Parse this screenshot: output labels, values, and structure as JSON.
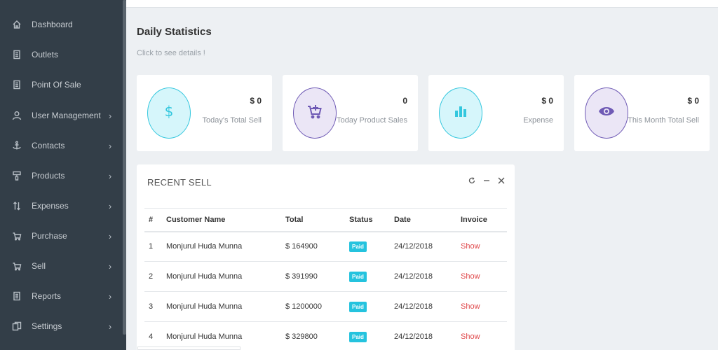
{
  "sidebar": {
    "items": [
      {
        "label": "Dashboard",
        "icon": "home-icon",
        "has_children": false
      },
      {
        "label": "Outlets",
        "icon": "document-icon",
        "has_children": false
      },
      {
        "label": "Point Of Sale",
        "icon": "document-icon",
        "has_children": false
      },
      {
        "label": "User Management",
        "icon": "user-icon",
        "has_children": true
      },
      {
        "label": "Contacts",
        "icon": "anchor-icon",
        "has_children": true
      },
      {
        "label": "Products",
        "icon": "paint-roller-icon",
        "has_children": true
      },
      {
        "label": "Expenses",
        "icon": "arrows-icon",
        "has_children": true
      },
      {
        "label": "Purchase",
        "icon": "cart-icon",
        "has_children": true
      },
      {
        "label": "Sell",
        "icon": "cart-icon",
        "has_children": true
      },
      {
        "label": "Reports",
        "icon": "document-icon",
        "has_children": true
      },
      {
        "label": "Settings",
        "icon": "copy-icon",
        "has_children": true
      }
    ],
    "chevron": "›"
  },
  "main": {
    "title": "Daily Statistics",
    "subtitle": "Click to see details !"
  },
  "stats": [
    {
      "value": "$ 0",
      "label": "Today's Total Sell",
      "icon": "dollar-icon",
      "color": "#33c7de"
    },
    {
      "value": "0",
      "label": "Today Product Sales",
      "icon": "cart-plus-icon",
      "color": "#6f5ab5"
    },
    {
      "value": "$ 0",
      "label": "Expense",
      "icon": "bar-chart-icon",
      "color": "#33c7de"
    },
    {
      "value": "$ 0",
      "label": "This Month Total Sell",
      "icon": "eye-icon",
      "color": "#6f5ab5"
    }
  ],
  "recent_sell": {
    "title": "RECENT SELL",
    "columns": [
      "#",
      "Customer Name",
      "Total",
      "Status",
      "Date",
      "Invoice"
    ],
    "rows": [
      {
        "num": "1",
        "customer": "Monjurul Huda Munna",
        "total": "$ 164900",
        "status": "Paid",
        "date": "24/12/2018",
        "invoice": "Show"
      },
      {
        "num": "2",
        "customer": "Monjurul Huda Munna",
        "total": "$ 391990",
        "status": "Paid",
        "date": "24/12/2018",
        "invoice": "Show"
      },
      {
        "num": "3",
        "customer": "Monjurul Huda Munna",
        "total": "$ 1200000",
        "status": "Paid",
        "date": "24/12/2018",
        "invoice": "Show"
      },
      {
        "num": "4",
        "customer": "Monjurul Huda Munna",
        "total": "$ 329800",
        "status": "Paid",
        "date": "24/12/2018",
        "invoice": "Show"
      }
    ]
  }
}
